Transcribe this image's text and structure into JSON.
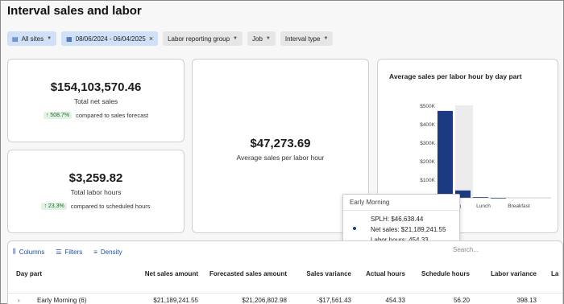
{
  "page": {
    "title": "Interval sales and labor"
  },
  "filters": {
    "sites": "All sites",
    "date_range": "08/06/2024 - 06/04/2025",
    "labor_group": "Labor reporting group",
    "job": "Job",
    "interval_type": "Interval type"
  },
  "kpis": {
    "net_sales": {
      "value": "$154,103,570.46",
      "label": "Total net sales",
      "badge": "↑ 508.7%",
      "compare": "compared to sales forecast"
    },
    "labor_hours": {
      "value": "$3,259.82",
      "label": "Total labor hours",
      "badge": "↑ 23.3%",
      "compare": "compared to scheduled hours"
    },
    "splh": {
      "value": "$47,273.69",
      "label": "Average sales per labor hour"
    }
  },
  "chart_data": {
    "type": "bar",
    "title": "Average sales per labor hour by day part",
    "categories": [
      "Early Morning",
      "",
      "Lunch",
      "Breakfast"
    ],
    "visible_tick_labels": [
      "$500K",
      "$400K",
      "$300K",
      "$200K",
      "$100K"
    ],
    "ylim": [
      0,
      500000
    ],
    "series": [
      {
        "values": [
          470000,
          40000,
          4000,
          0
        ]
      }
    ],
    "background_bar_values": [
      500000,
      0,
      0,
      0
    ],
    "colors": {
      "bar": "#1c3a82",
      "hover": "#ececec"
    }
  },
  "tooltip": {
    "title": "Early Morning",
    "splh": "SPLH: $46,638.44",
    "net_sales": "Net sales: $21,189,241.55",
    "labor_hours": "Labor hours: 454.33"
  },
  "table": {
    "toolbar": {
      "columns": "Columns",
      "filters": "Filters",
      "density": "Density",
      "search_placeholder": "Search..."
    },
    "headers": [
      "Day part",
      "Net sales amount",
      "Forecasted sales amount",
      "Sales variance",
      "Actual hours",
      "Schedule hours",
      "Labor variance",
      "La"
    ],
    "rows": [
      {
        "day_part": "Early Morning (6)",
        "expander": "›",
        "net_sales": "$21,189,241.55",
        "forecast": "$21,206,802.98",
        "variance": "-$17,561.43",
        "actual": "454.33",
        "schedule": "56.20",
        "labor_var": "398.13"
      }
    ]
  },
  "colors": {
    "accent": "#1f4fa0",
    "bar": "#1c3a82",
    "badge_bg": "#e3f3e3",
    "badge_fg": "#1e6b2b"
  }
}
